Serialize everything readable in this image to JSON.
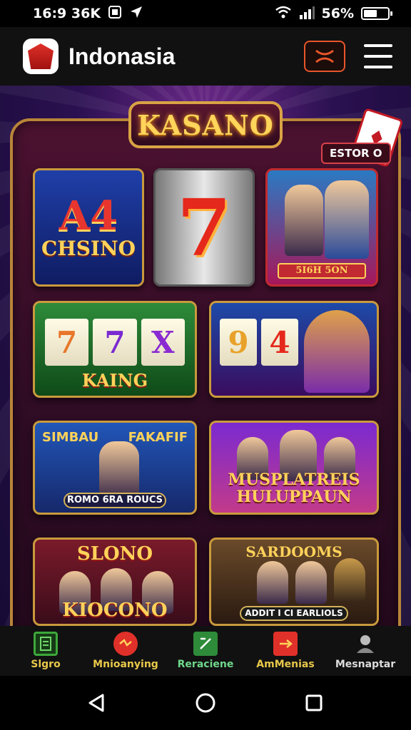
{
  "status_bar": {
    "time": "16:9 36K",
    "battery": "56%",
    "battery_level": 0.56
  },
  "app_bar": {
    "title": "Indonasia",
    "cast_icon": "cast-icon",
    "menu_icon": "hamburger-menu-icon"
  },
  "casino": {
    "marquee": "KASANO",
    "badge": "ESTOR O",
    "tiles": {
      "t1_big": "A4",
      "t1_small": "CHSINO",
      "t2_symbol": "7",
      "t3_label": "5I6H 5ON",
      "t4_reels": [
        "7",
        "7",
        "X"
      ],
      "t4_label": "KAING",
      "t5_reels": [
        "9",
        "4"
      ],
      "t6_top": "SIMBAU",
      "t6_side": "FAKAFIF",
      "t6_label": "ROMO 6RA ROUCS",
      "t7_label": "MUSPLATREIS HULUPPAUN",
      "t8_top": "SLONO",
      "t8_bottom": "KIOCONO",
      "t9_top": "SARDOOMS",
      "t9_label": "ADDIT I CI EARLIOLS"
    }
  },
  "bottom_nav": {
    "items": [
      {
        "label": "Slgro",
        "icon": "slots-icon",
        "color": "#3da83a"
      },
      {
        "label": "Mnioanying",
        "icon": "promo-icon",
        "color": "#e0302a"
      },
      {
        "label": "Reraciene",
        "icon": "games-icon",
        "color": "#2e8b3a"
      },
      {
        "label": "AmMenias",
        "icon": "casino-icon",
        "color": "#e0302a"
      },
      {
        "label": "Mesnaptar",
        "icon": "profile-icon",
        "color": "#888888"
      }
    ]
  },
  "system_nav": {
    "back_icon": "back-triangle-icon",
    "home_icon": "home-circle-icon",
    "recents_icon": "recents-square-icon"
  }
}
